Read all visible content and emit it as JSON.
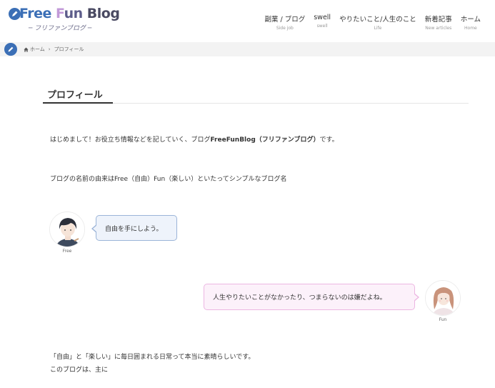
{
  "site": {
    "logo_part1": "Free",
    "logo_part2_first": "F",
    "logo_part2_rest": "un",
    "logo_part3": "Blog",
    "logo_sub": "─ フリファンブログ ─"
  },
  "nav": [
    {
      "label": "副業 / ブログ",
      "sub": "Side job"
    },
    {
      "label": "swell",
      "sub": "swell"
    },
    {
      "label": "やりたいこと/人生のこと",
      "sub": "Life"
    },
    {
      "label": "新着記事",
      "sub": "New articles"
    },
    {
      "label": "ホーム",
      "sub": "Home"
    }
  ],
  "breadcrumb": {
    "home": "ホーム",
    "separator": "›",
    "current": "プロフィール"
  },
  "page": {
    "title": "プロフィール",
    "intro_before": "はじめまして！お役立ち情報などを記していく、ブログ",
    "intro_bold": "FreeFunBlog（フリファンブログ）",
    "intro_after": "です。",
    "name_origin": "ブログの名前の由来はFree（自由）Fun（楽しい）といたってシンプルなブログ名",
    "closing_1": "「自由」と「楽しい」に毎日囲まれる日常って本当に素晴らしいです。",
    "closing_2": "このブログは、主に"
  },
  "dialog": {
    "left": {
      "name": "Free",
      "text": "自由を手にしよう。"
    },
    "right": {
      "name": "Fun",
      "text": "人生やりたいことがなかったり、つまらないのは嫌だよね。"
    }
  },
  "colors": {
    "brand_blue": "#3b6fb6",
    "left_balloon_bg": "#eef3fb",
    "left_balloon_border": "#9bb4d8",
    "right_balloon_bg": "#fcf1fa",
    "right_balloon_border": "#ecb6e2"
  },
  "icons": {
    "edit": "pencil-icon",
    "home": "home-icon",
    "breadcrumb_separator": "chevron-right-icon"
  }
}
